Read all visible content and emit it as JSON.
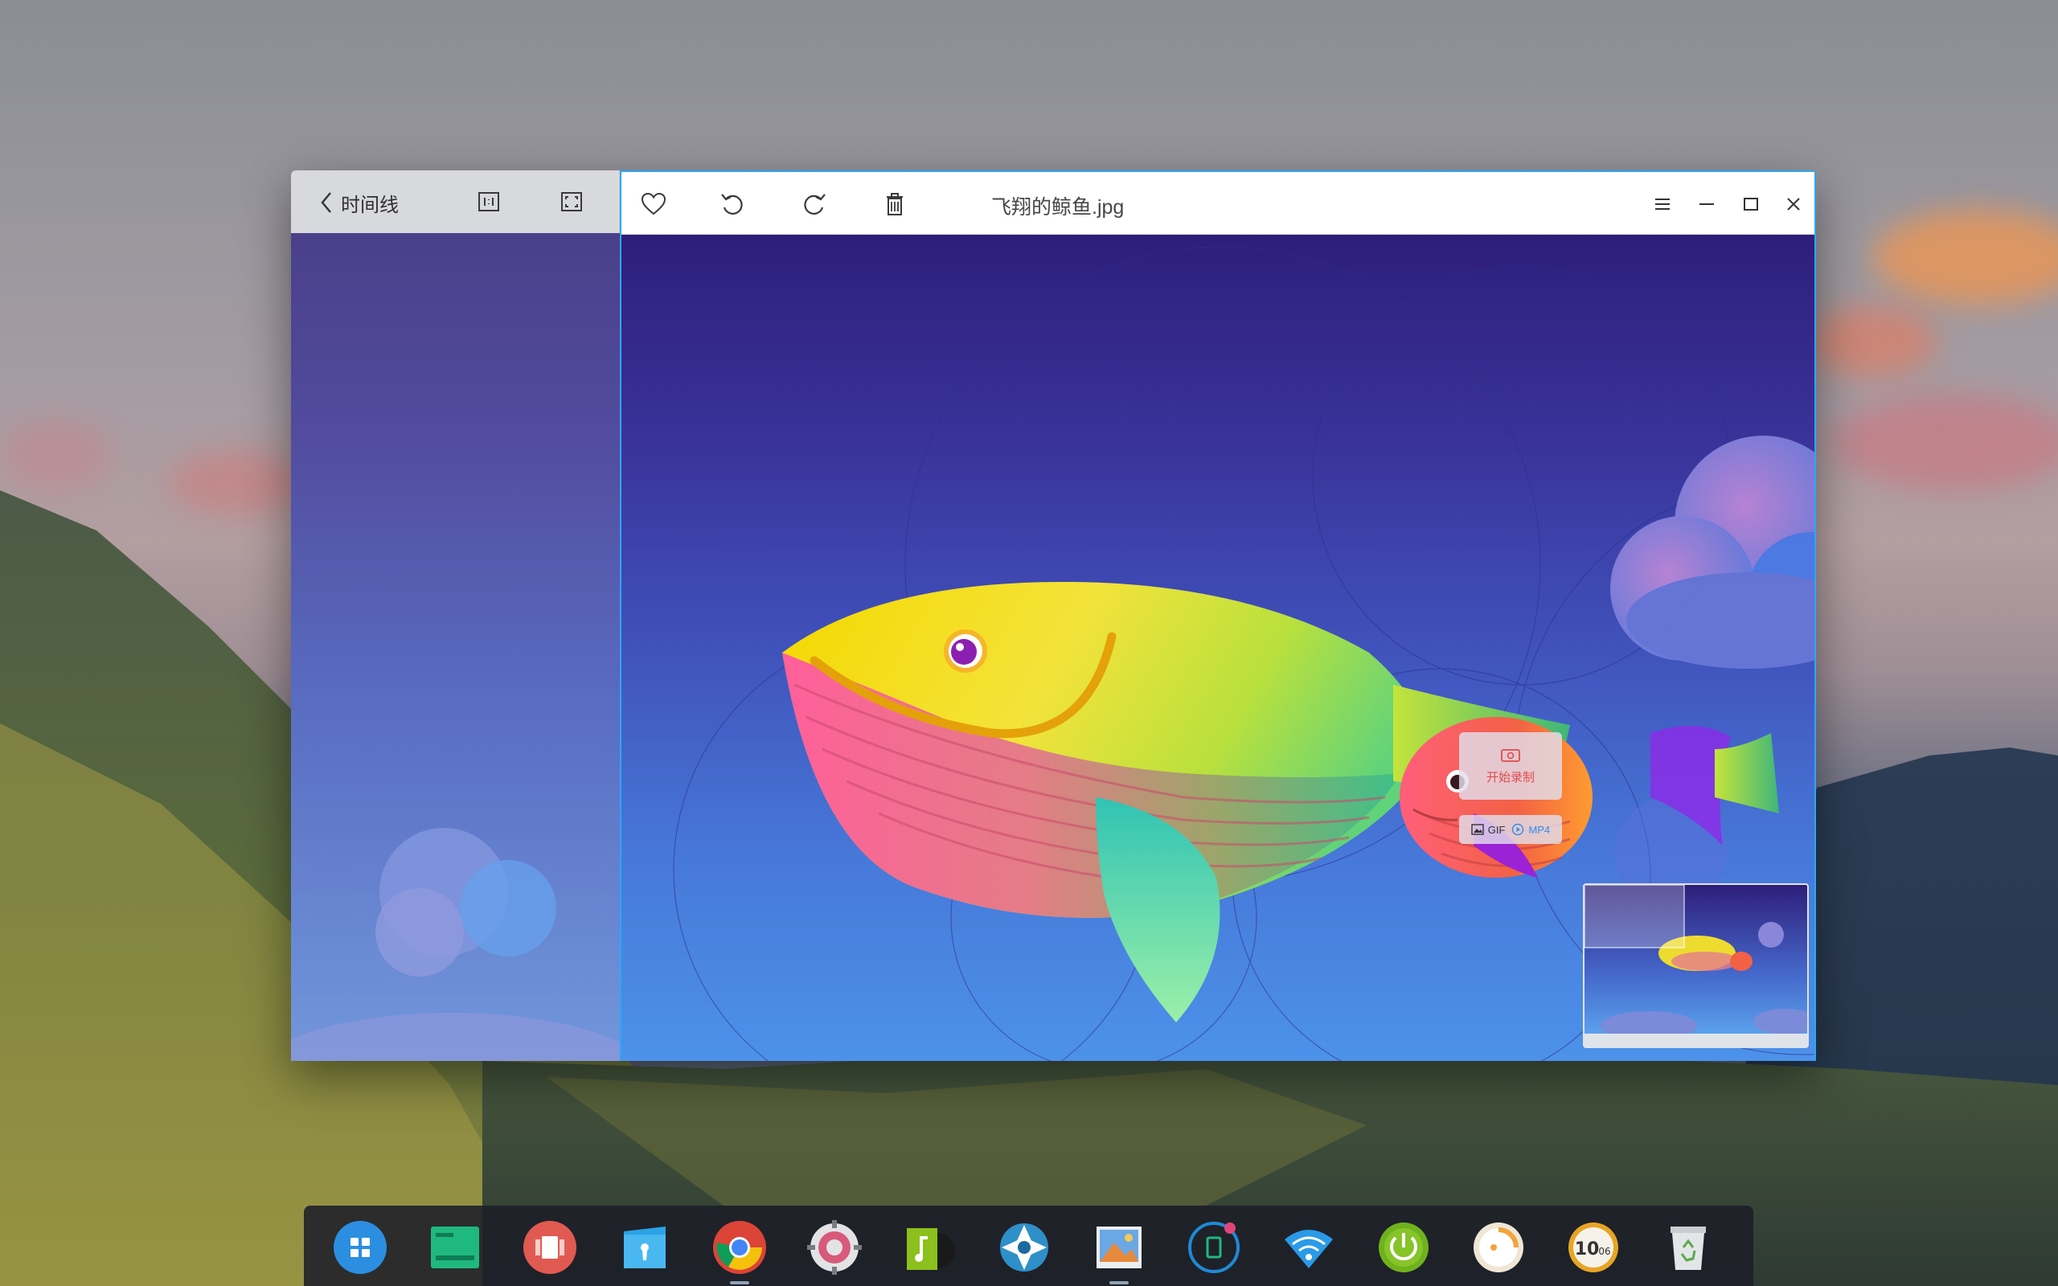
{
  "window": {
    "back_label": "时间线",
    "file_title": "飞翔的鲸鱼.jpg"
  },
  "recorder": {
    "start_label": "开始录制",
    "gif_label": "GIF",
    "mp4_label": "MP4"
  },
  "dock": {
    "items": [
      {
        "icon": "launcher-icon"
      },
      {
        "icon": "multitask-icon"
      },
      {
        "icon": "movie-icon"
      },
      {
        "icon": "file-manager-icon"
      },
      {
        "icon": "chrome-icon"
      },
      {
        "icon": "control-center-icon"
      },
      {
        "icon": "music-icon"
      },
      {
        "icon": "screenshot-icon"
      },
      {
        "icon": "image-viewer-icon",
        "active": true
      },
      {
        "icon": "notification-center-icon"
      },
      {
        "icon": "wifi-icon"
      },
      {
        "icon": "power-icon"
      },
      {
        "icon": "clock-icon"
      },
      {
        "icon": "calendar-clock-icon",
        "label": "10"
      },
      {
        "icon": "trash-icon"
      }
    ]
  },
  "colors": {
    "accent": "#2ca7f8",
    "record_red": "#e24b4b",
    "mp4_blue": "#2b8fe8"
  }
}
